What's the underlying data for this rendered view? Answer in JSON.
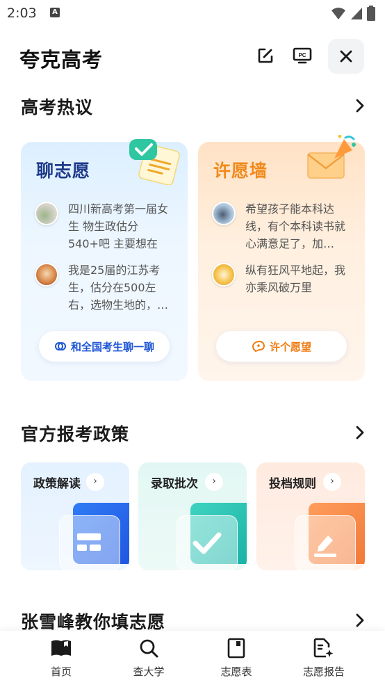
{
  "status_bar": {
    "time": "2:03",
    "notif_icon": "app-notification-icon"
  },
  "header": {
    "title": "夸克高考",
    "edit_icon": "edit-icon",
    "pc_icon": "pc-icon",
    "close_icon": "close-icon"
  },
  "hot_section": {
    "title": "高考热议",
    "chat_card": {
      "title": "聊志愿",
      "posts": [
        {
          "text": "四川新高考第一届女生 物生政估分540+吧 主要想在川…"
        },
        {
          "text": "我是25届的江苏考生，估分在500左右，选物生地的，…"
        }
      ],
      "button_label": "和全国考生聊一聊"
    },
    "wish_card": {
      "title": "许愿墙",
      "posts": [
        {
          "text": "希望孩子能本科达线，有个本科读书就心满意足了，加…"
        },
        {
          "text": "纵有狂风平地起，我亦乘风破万里"
        }
      ],
      "button_label": "许个愿望"
    }
  },
  "policy_section": {
    "title": "官方报考政策",
    "tiles": [
      {
        "label": "政策解读",
        "arrow": "›",
        "accent": "#2f6bf0"
      },
      {
        "label": "录取批次",
        "arrow": "›",
        "accent": "#25b8b0"
      },
      {
        "label": "投档规则",
        "arrow": "›",
        "accent": "#f5894a"
      }
    ]
  },
  "teacher_section": {
    "title": "张雪峰教你填志愿"
  },
  "bottom_nav": {
    "items": [
      {
        "label": "首页",
        "icon": "book-icon"
      },
      {
        "label": "查大学",
        "icon": "search-icon"
      },
      {
        "label": "志愿表",
        "icon": "form-icon"
      },
      {
        "label": "志愿报告",
        "icon": "report-icon"
      }
    ]
  }
}
